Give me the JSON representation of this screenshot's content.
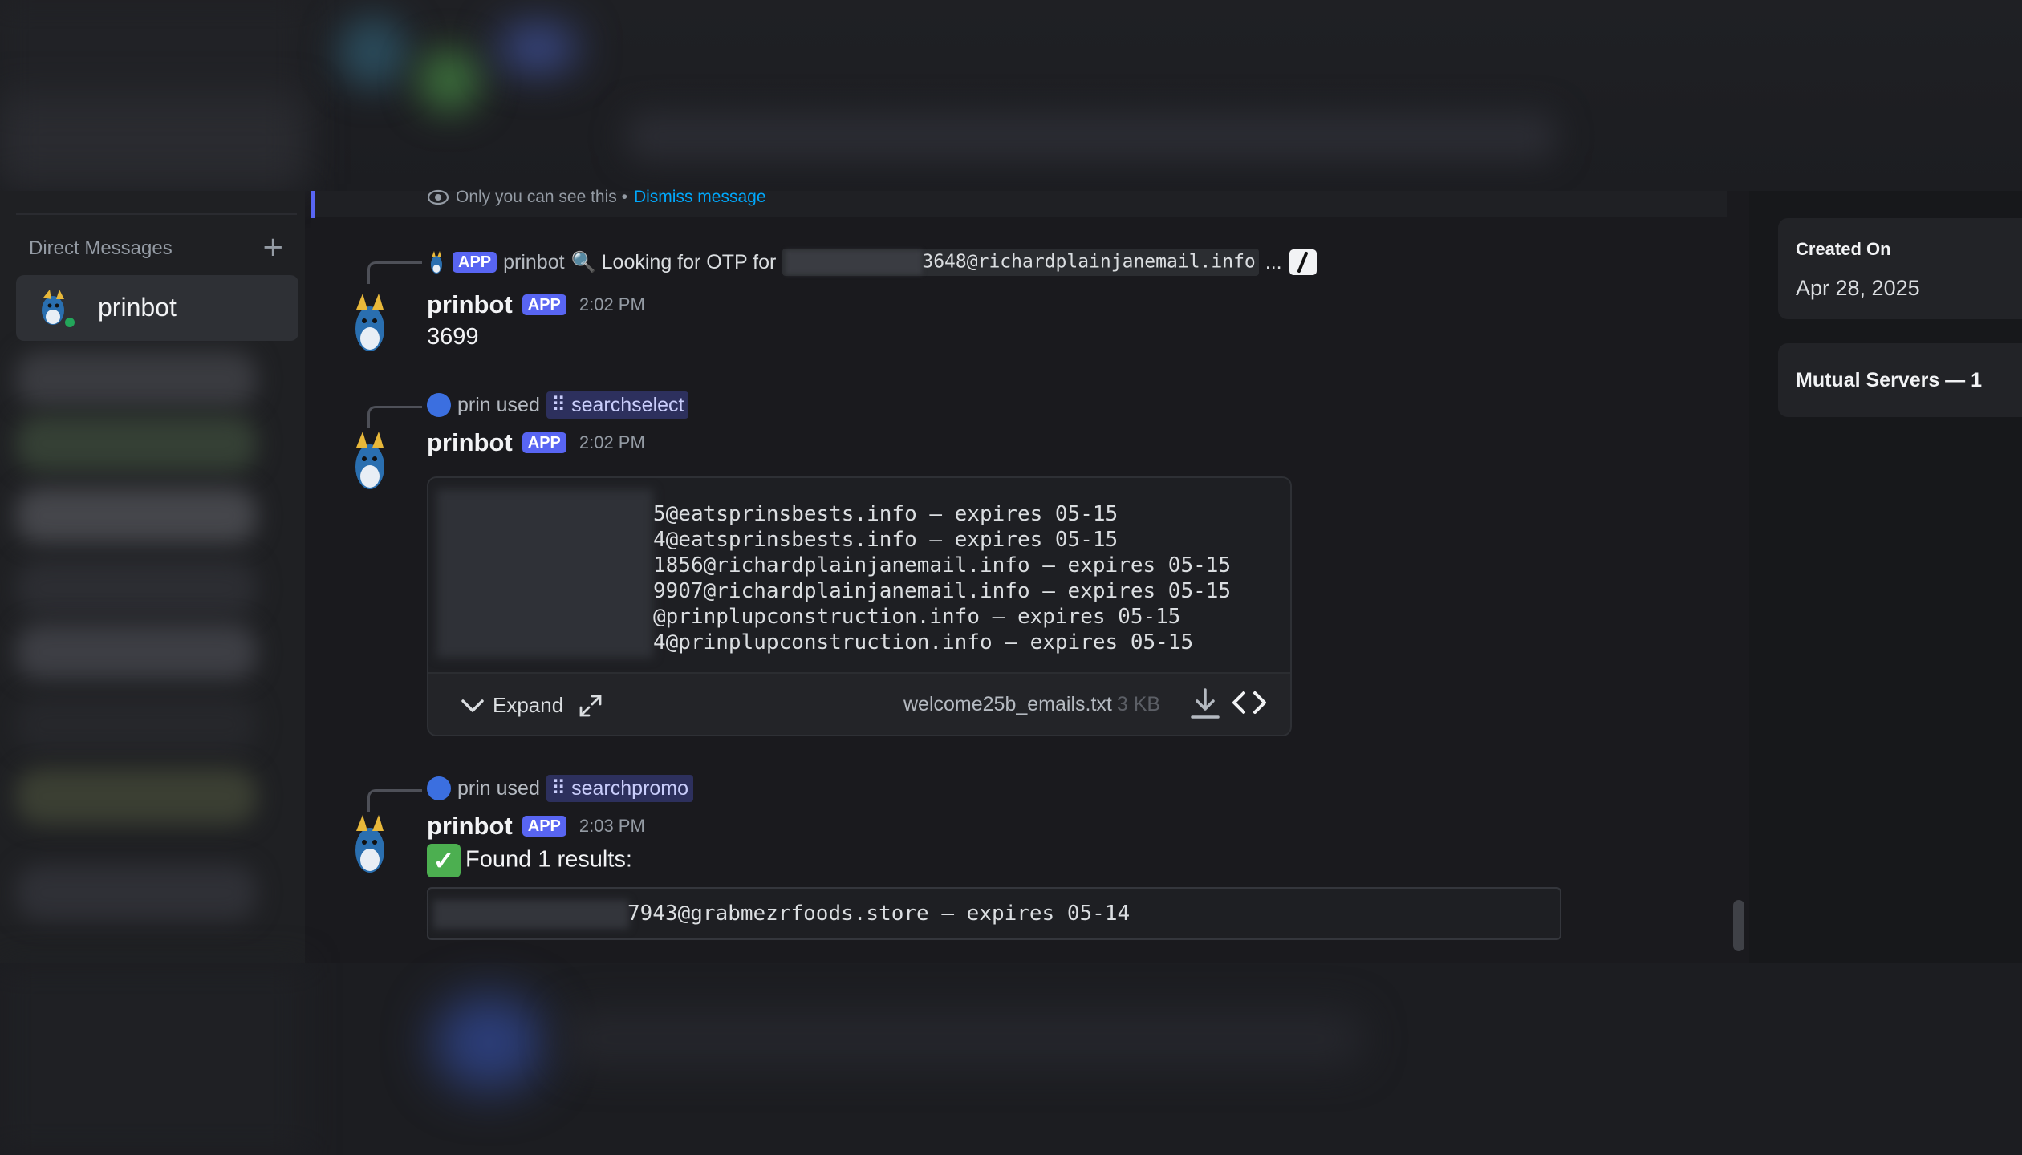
{
  "sidebar": {
    "dm_header": "Direct Messages",
    "dm_add": "+",
    "dm_items": [
      {
        "label": "prinbot",
        "status": "online"
      }
    ]
  },
  "ephemeral": {
    "notice": "Only you can see this •",
    "dismiss": "Dismiss message"
  },
  "messages": [
    {
      "reply_author": "prinbot",
      "reply_text": "🔍 Looking for OTP for",
      "reply_email": "3648@richardplainjanemail.info",
      "reply_ellipsis": "...",
      "author": "prinbot",
      "app_tag": "APP",
      "time": "2:02 PM",
      "content": "3699"
    },
    {
      "used_by": "prin used",
      "command": "searchselect",
      "author": "prinbot",
      "app_tag": "APP",
      "time": "2:02 PM",
      "file": {
        "lines": [
          "5@eatsprinsbests.info — expires 05-15",
          "4@eatsprinsbests.info — expires 05-15",
          "1856@richardplainjanemail.info — expires 05-15",
          "9907@richardplainjanemail.info — expires 05-15",
          "@prinplupconstruction.info — expires 05-15",
          "4@prinplupconstruction.info — expires 05-15"
        ],
        "expand_label": "Expand",
        "filename": "welcome25b_emails.txt",
        "size": "3 KB"
      }
    },
    {
      "used_by": "prin used",
      "command": "searchpromo",
      "author": "prinbot",
      "app_tag": "APP",
      "time": "2:03 PM",
      "content": "Found 1 results:",
      "result": "7943@grabmezrfoods.store — expires 05-14"
    }
  ],
  "profile": {
    "created_label": "Created On",
    "created_value": "Apr 28, 2025",
    "mutual_servers": "Mutual Servers — 1"
  },
  "colors": {
    "accent": "#5865f2",
    "link": "#00a8fc",
    "online": "#23a55a",
    "check": "#4caf50"
  }
}
